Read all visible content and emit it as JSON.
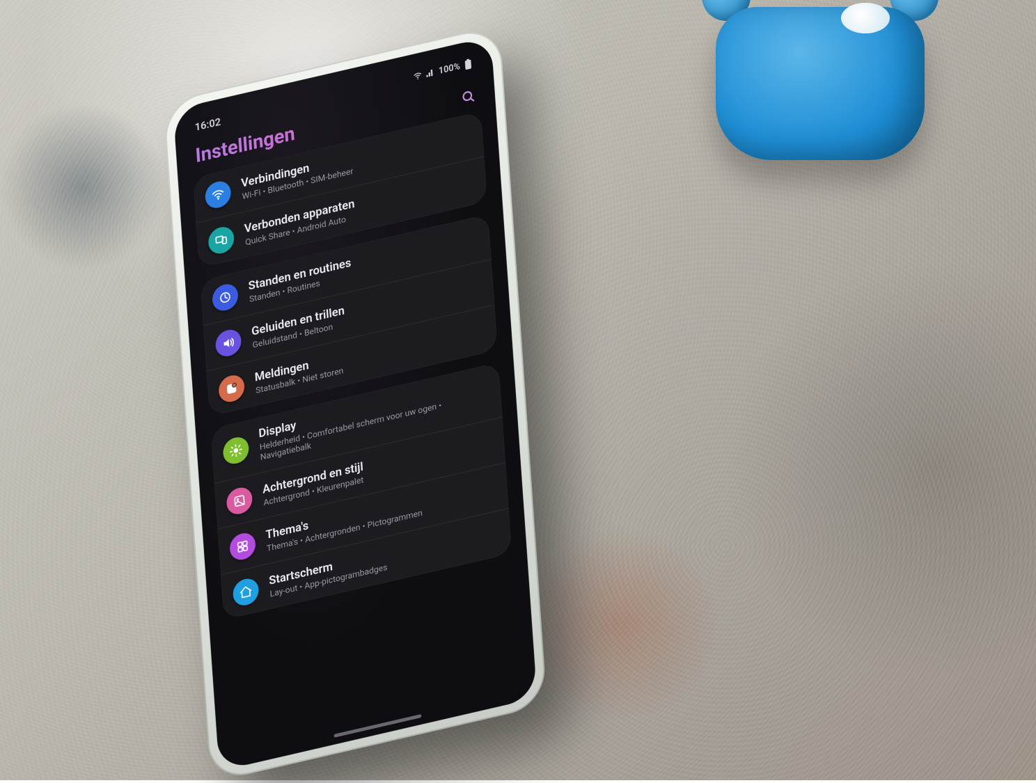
{
  "statusbar": {
    "time": "16:02",
    "battery_text": "100%"
  },
  "header": {
    "title": "Instellingen"
  },
  "groups": [
    {
      "items": [
        {
          "icon": "wifi",
          "color": "#2a7fe0",
          "title": "Verbindingen",
          "sub": "Wi-Fi • Bluetooth • SIM-beheer"
        },
        {
          "icon": "devices",
          "color": "#1aa5a5",
          "title": "Verbonden apparaten",
          "sub": "Quick Share • Android Auto"
        }
      ]
    },
    {
      "items": [
        {
          "icon": "routine",
          "color": "#3b5be0",
          "title": "Standen en routines",
          "sub": "Standen • Routines"
        },
        {
          "icon": "sound",
          "color": "#6a52e0",
          "title": "Geluiden en trillen",
          "sub": "Geluidstand • Beltoon"
        },
        {
          "icon": "notif",
          "color": "#d66b4b",
          "title": "Meldingen",
          "sub": "Statusbalk • Niet storen"
        }
      ]
    },
    {
      "items": [
        {
          "icon": "display",
          "color": "#7fbf2f",
          "title": "Display",
          "sub": "Helderheid • Comfortabel scherm voor uw ogen • Navigatiebalk"
        },
        {
          "icon": "wall",
          "color": "#d95aa0",
          "title": "Achtergrond en stijl",
          "sub": "Achtergrond • Kleurenpalet"
        },
        {
          "icon": "themes",
          "color": "#b44be0",
          "title": "Thema's",
          "sub": "Thema's • Achtergronden • Pictogrammen"
        },
        {
          "icon": "home",
          "color": "#1f9fe0",
          "title": "Startscherm",
          "sub": "Lay-out • App-pictogrambadges"
        }
      ]
    }
  ]
}
